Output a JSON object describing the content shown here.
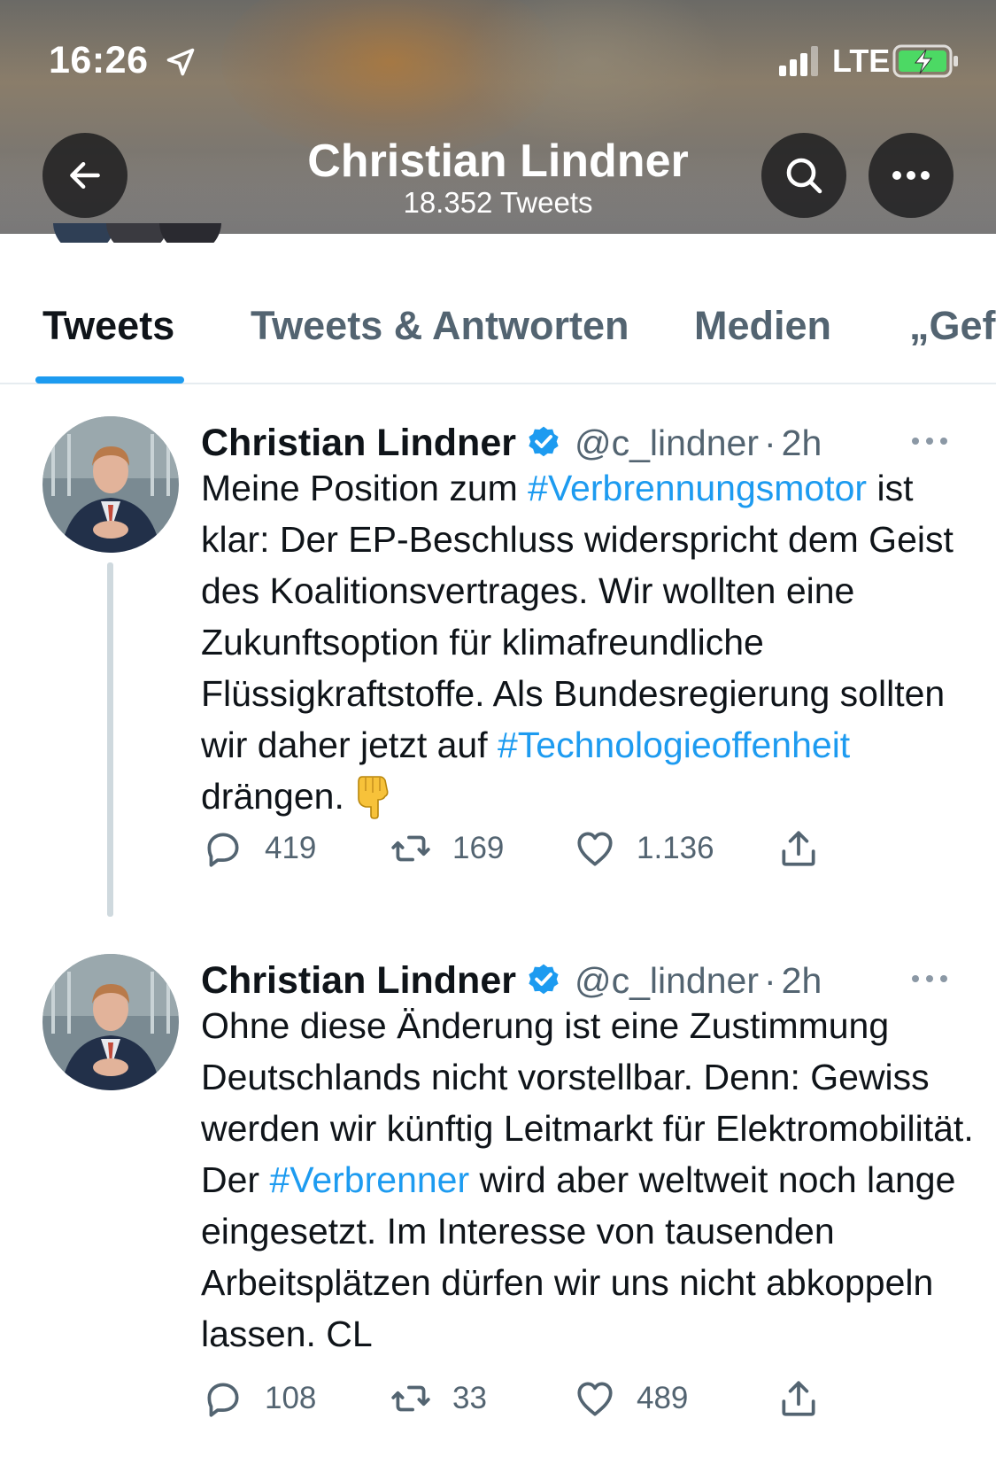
{
  "status_bar": {
    "time": "16:26",
    "network": "LTE"
  },
  "header": {
    "title": "Christian Lindner",
    "subtitle": "18.352 Tweets"
  },
  "tabs": [
    {
      "label": "Tweets",
      "active": true
    },
    {
      "label": "Tweets & Antworten",
      "active": false
    },
    {
      "label": "Medien",
      "active": false
    },
    {
      "label": "„Gef",
      "active": false
    }
  ],
  "tweets": [
    {
      "name": "Christian Lindner",
      "handle": "@c_lindner",
      "dot": "·",
      "time": "2h",
      "text_parts": [
        {
          "text": "Meine Position zum ",
          "tag": false
        },
        {
          "text": "#Verbrennungsmotor",
          "tag": true
        },
        {
          "text": " ist klar: Der EP-Beschluss widerspricht dem Geist des Koalitionsvertrages. Wir wollten eine Zukunftsoption für klimafreundliche Flüssigkraftstoffe. Als Bundesregierung sollten wir daher jetzt auf ",
          "tag": false
        },
        {
          "text": "#Technologieoffenheit",
          "tag": true
        },
        {
          "text": " drängen.",
          "tag": false
        }
      ],
      "emoji": "backhand-index-pointing-down",
      "replies": "419",
      "retweets": "169",
      "likes": "1.136"
    },
    {
      "name": "Christian Lindner",
      "handle": "@c_lindner",
      "dot": "·",
      "time": "2h",
      "text_parts": [
        {
          "text": "Ohne diese Änderung ist eine Zustimmung Deutschlands nicht vorstellbar. Denn: Gewiss werden wir künftig Leitmarkt für Elektromobilität. Der ",
          "tag": false
        },
        {
          "text": "#Verbrenner",
          "tag": true
        },
        {
          "text": " wird aber weltweit noch lange eingesetzt. Im Interesse von tausenden Arbeitsplätzen dürfen wir uns nicht abkoppeln lassen. CL",
          "tag": false
        }
      ],
      "replies": "108",
      "retweets": "33",
      "likes": "489"
    }
  ],
  "colors": {
    "accent": "#1d9bf0",
    "text": "#0f1419",
    "secondary": "#536471",
    "verified": "#1d9bf0"
  },
  "icons": [
    "location-arrow-icon",
    "signal-icon",
    "battery-charging-icon",
    "back-arrow-icon",
    "search-icon",
    "more-icon",
    "verified-badge-icon",
    "reply-icon",
    "retweet-icon",
    "like-icon",
    "share-icon"
  ]
}
